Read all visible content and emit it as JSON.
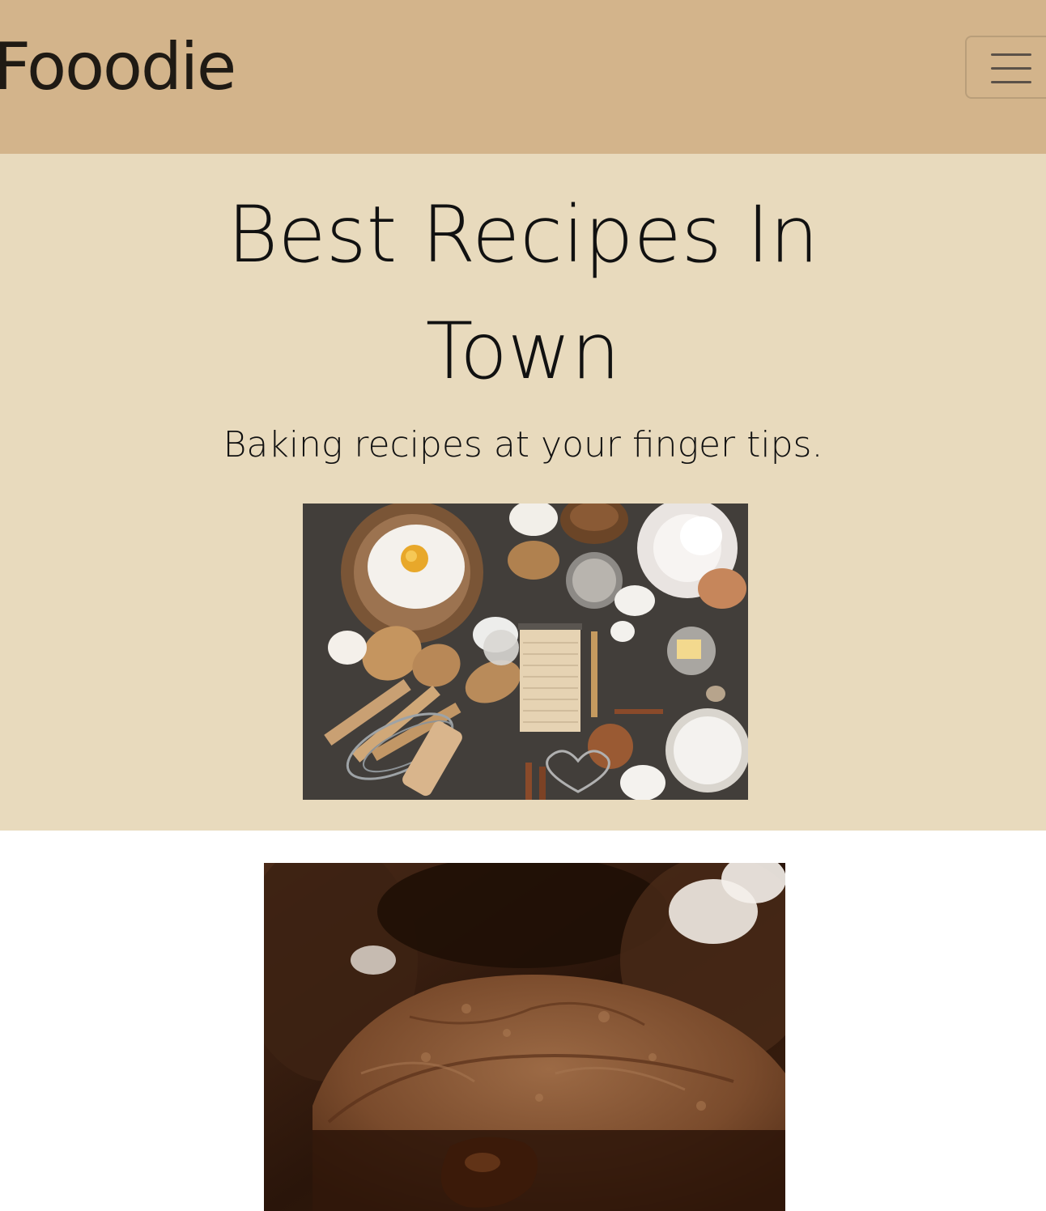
{
  "navbar": {
    "brand": "Fooodie",
    "toggle_icon": "hamburger-menu-icon",
    "background_color": "#d3b48b"
  },
  "hero": {
    "title": "Best Recipes In Town",
    "subtitle": "Baking recipes at your finger tips.",
    "background_color": "#e8dabd",
    "image_subject": "baking ingredients flat lay"
  },
  "featured": {
    "image_subject": "chocolate brownie close-up"
  }
}
